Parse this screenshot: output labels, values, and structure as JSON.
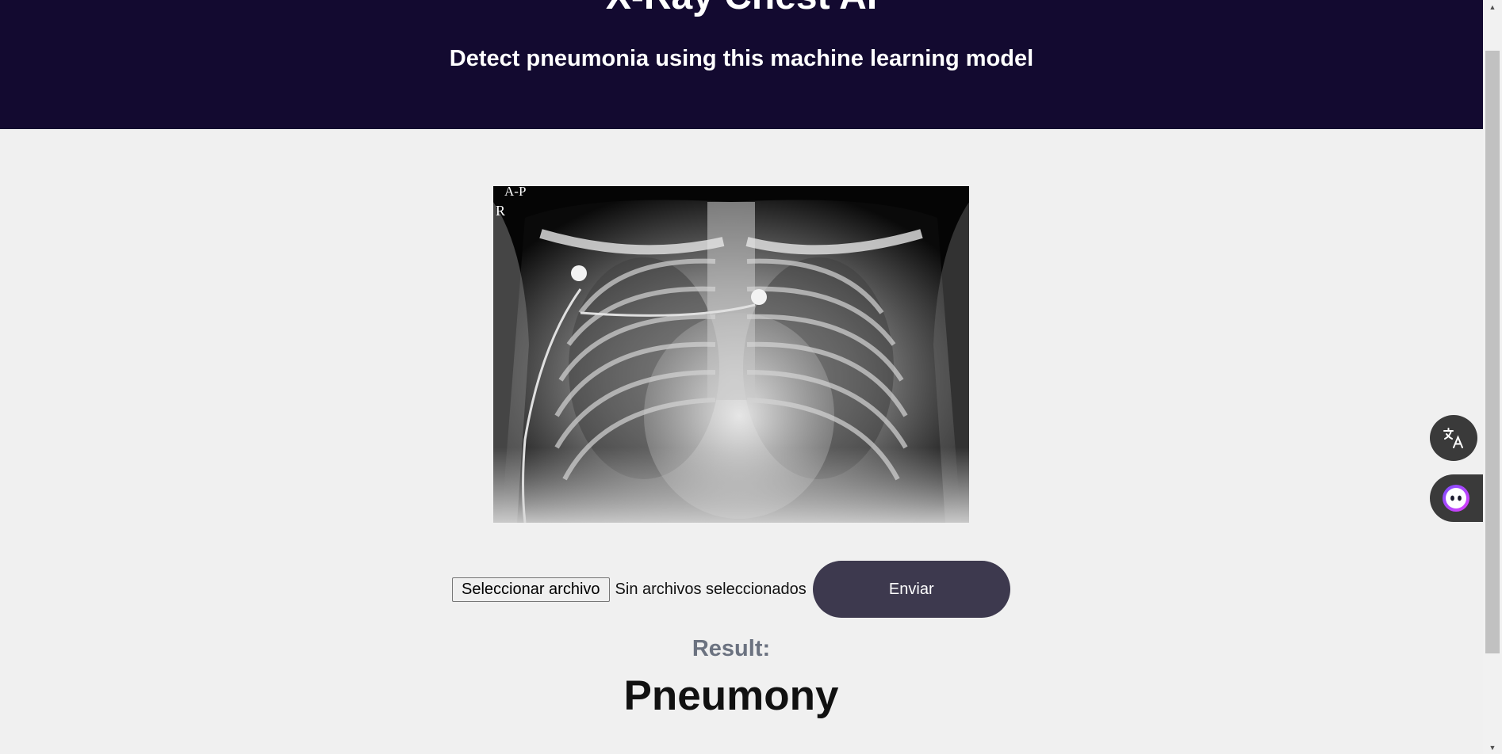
{
  "header": {
    "title": "X-Ray Chest AI",
    "subtitle": "Detect pneumonia using this machine learning model",
    "background": "#130a30"
  },
  "xray": {
    "marker_view": "A-P",
    "marker_side": "R"
  },
  "upload": {
    "file_button_label": "Seleccionar archivo",
    "file_status": "Sin archivos seleccionados",
    "submit_label": "Enviar"
  },
  "result": {
    "label": "Result:",
    "value": "Pneumony"
  },
  "widgets": {
    "translate_icon": "translate-icon",
    "assistant_icon": "assistant-face-icon"
  },
  "colors": {
    "submit_button": "#3d394e",
    "result_label": "#6b7280",
    "page_background": "#f0f0f0"
  }
}
